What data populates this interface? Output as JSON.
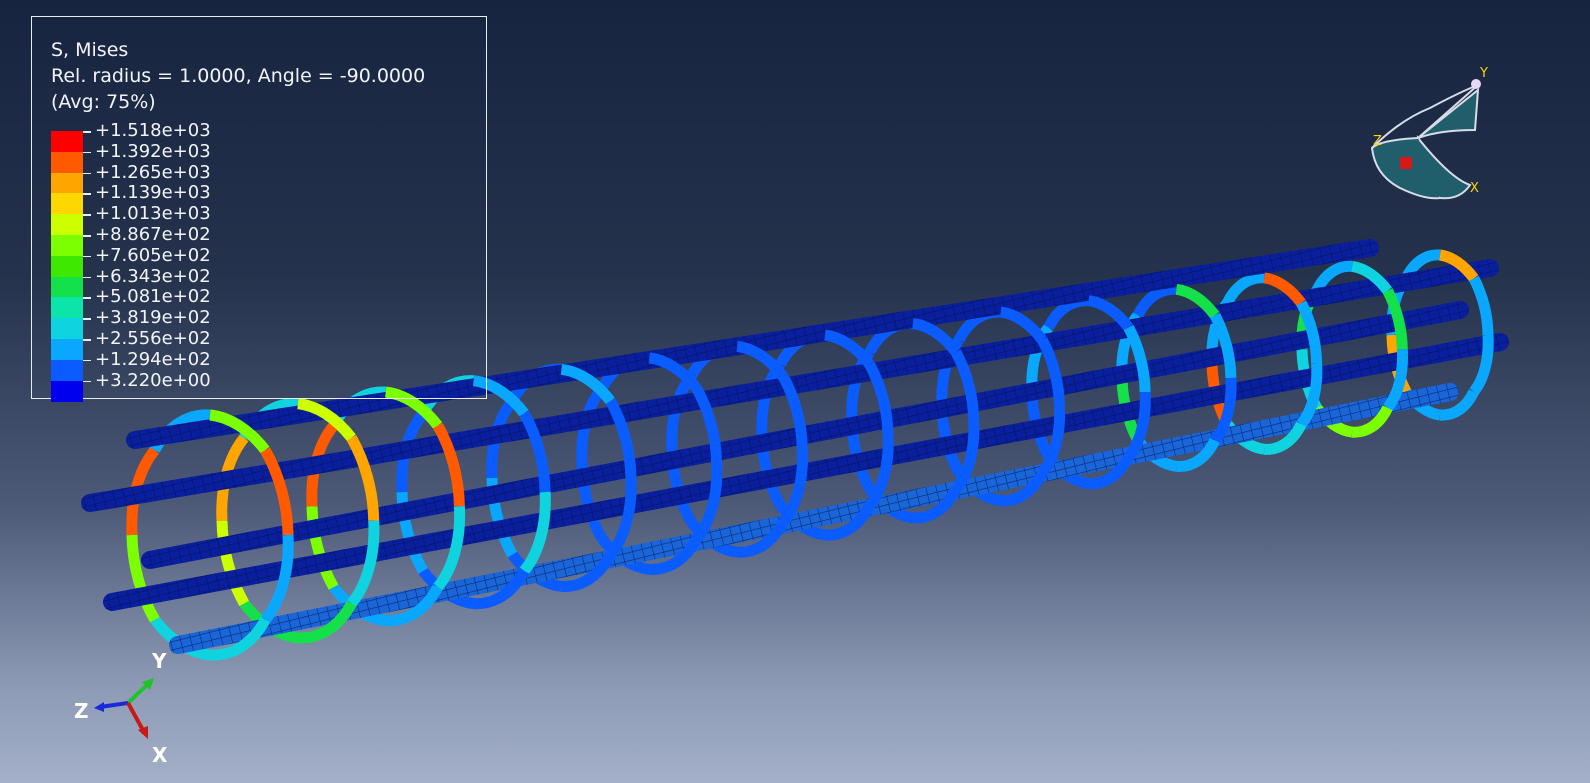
{
  "legend": {
    "title": "S, Mises",
    "subtitle": "Rel. radius = 1.0000, Angle = -90.0000",
    "averaging": "(Avg: 75%)",
    "labels": [
      "+1.518e+03",
      "+1.392e+03",
      "+1.265e+03",
      "+1.139e+03",
      "+1.013e+03",
      "+8.867e+02",
      "+7.605e+02",
      "+6.343e+02",
      "+5.081e+02",
      "+3.819e+02",
      "+2.556e+02",
      "+1.294e+02",
      "+3.220e+00"
    ],
    "colors": [
      "#ff0000",
      "#ff5a00",
      "#ffa500",
      "#ffd700",
      "#ccff00",
      "#7cff00",
      "#3ee800",
      "#14e04a",
      "#0be6a8",
      "#0fd4e0",
      "#0aa7ff",
      "#0a5cff",
      "#0000ee"
    ]
  },
  "triad": {
    "y_label": "Y",
    "z_label": "Z",
    "x_label": "X"
  },
  "compass": {
    "y_label": "Y",
    "z_label": "Z",
    "x_label": "X"
  },
  "model": {
    "bar_color": "#0a1f9e",
    "ring_base_color": "#0a5cff"
  }
}
